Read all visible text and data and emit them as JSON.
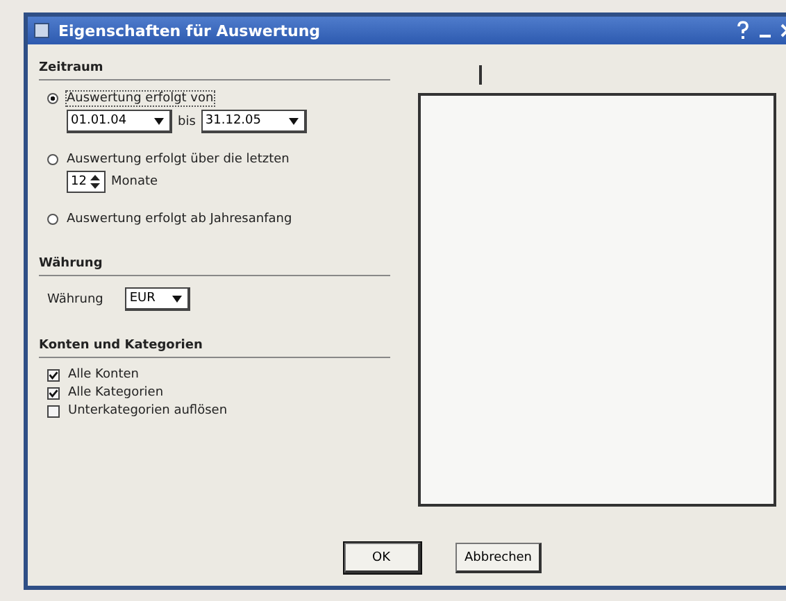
{
  "window": {
    "title": "Eigenschaften für Auswertung"
  },
  "zeitraum": {
    "heading": "Zeitraum",
    "options": [
      {
        "kind": "range",
        "label": "Auswertung erfolgt von",
        "selected": true,
        "from": "01.01.04",
        "between": "bis",
        "to": "31.12.05"
      },
      {
        "kind": "months",
        "label": "Auswertung erfolgt über die letzten",
        "selected": false,
        "count": "12",
        "unit": "Monate"
      },
      {
        "kind": "plain",
        "label": "Auswertung erfolgt ab Jahresanfang",
        "selected": false
      }
    ]
  },
  "waehrung": {
    "heading": "Währung",
    "label": "Währung",
    "value": "EUR"
  },
  "konten": {
    "heading": "Konten und Kategorien",
    "checkboxes": [
      {
        "label": "Alle Konten",
        "checked": true
      },
      {
        "label": "Alle Kategorien",
        "checked": true
      },
      {
        "label": "Unterkategorien auflösen",
        "checked": false
      }
    ]
  },
  "buttons": [
    "OK",
    "Abbrechen"
  ]
}
